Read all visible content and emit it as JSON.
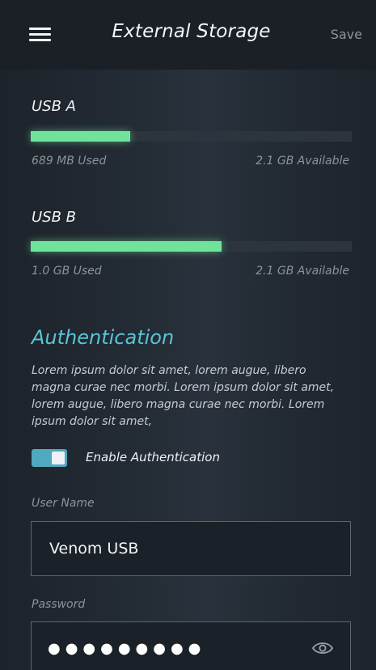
{
  "header": {
    "title": "External Storage",
    "save_label": "Save"
  },
  "storage": [
    {
      "label": "USB A",
      "used_label": "689 MB Used",
      "available_label": "2.1 GB Available",
      "used_fraction": 0.31
    },
    {
      "label": "USB B",
      "used_label": "1.0 GB Used",
      "available_label": "2.1 GB Available",
      "used_fraction": 0.595
    }
  ],
  "auth": {
    "title": "Authentication",
    "description": "Lorem ipsum dolor sit amet, lorem augue, libero magna curae nec morbi. Lorem ipsum dolor sit amet, lorem augue, libero magna curae nec morbi. Lorem ipsum dolor sit amet,",
    "toggle_label": "Enable Authentication",
    "toggle_on": true
  },
  "form": {
    "username_label": "User Name",
    "username_value": "Venom USB",
    "password_label": "Password",
    "password_masked": "●●●●●●●●●"
  },
  "colors": {
    "accent": "#58c5d6",
    "bar_fill": "#6fe39a",
    "toggle_on": "#4fa9bf"
  },
  "icons": {
    "menu": "hamburger-menu-icon",
    "password_visibility": "eye-icon"
  }
}
